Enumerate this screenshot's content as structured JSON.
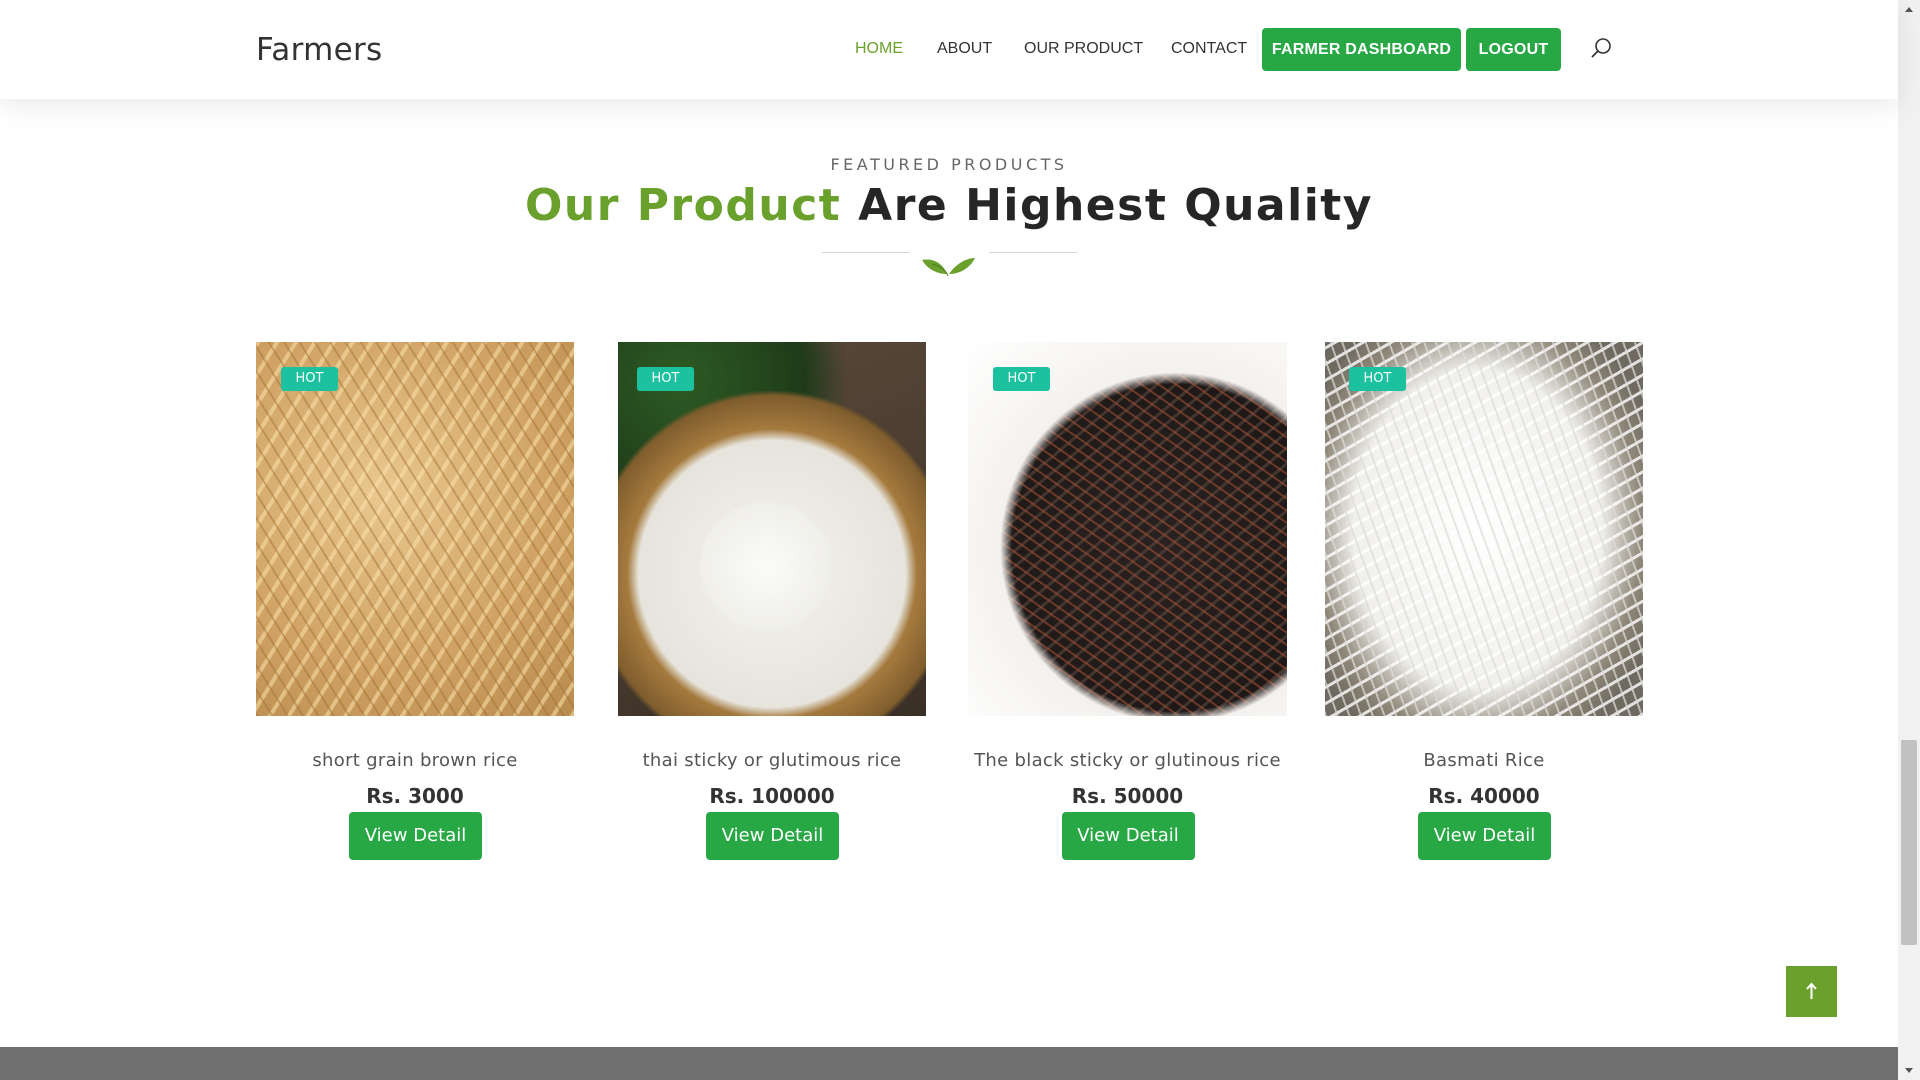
{
  "brand": "Farmers",
  "nav": {
    "home": "HOME",
    "about": "ABOUT",
    "our_product": "OUR PRODUCT",
    "contact": "CONTACT",
    "farmer_dashboard": "FARMER DASHBOARD",
    "logout": "LOGOUT"
  },
  "section": {
    "eyebrow": "FEATURED PRODUCTS",
    "title_accent": "Our Product",
    "title_rest": "Are Highest Quality"
  },
  "products": [
    {
      "badge": "HOT",
      "name": "short grain brown rice",
      "price": "Rs. 3000",
      "button": "View Detail"
    },
    {
      "badge": "HOT",
      "name": "thai sticky or glutimous rice",
      "price": "Rs. 100000",
      "button": "View Detail"
    },
    {
      "badge": "HOT",
      "name": "The black sticky or glutinous rice",
      "price": "Rs. 50000",
      "button": "View Detail"
    },
    {
      "badge": "HOT",
      "name": "Basmati Rice",
      "price": "Rs. 40000",
      "button": "View Detail"
    }
  ],
  "colors": {
    "accent_green": "#6aa12d",
    "button_green": "#28a745",
    "badge_teal": "#1cc1a0"
  },
  "icons": [
    "search-icon",
    "leaf-icon",
    "arrow-up-icon",
    "scroll-up-arrow-icon",
    "scroll-down-arrow-icon"
  ]
}
